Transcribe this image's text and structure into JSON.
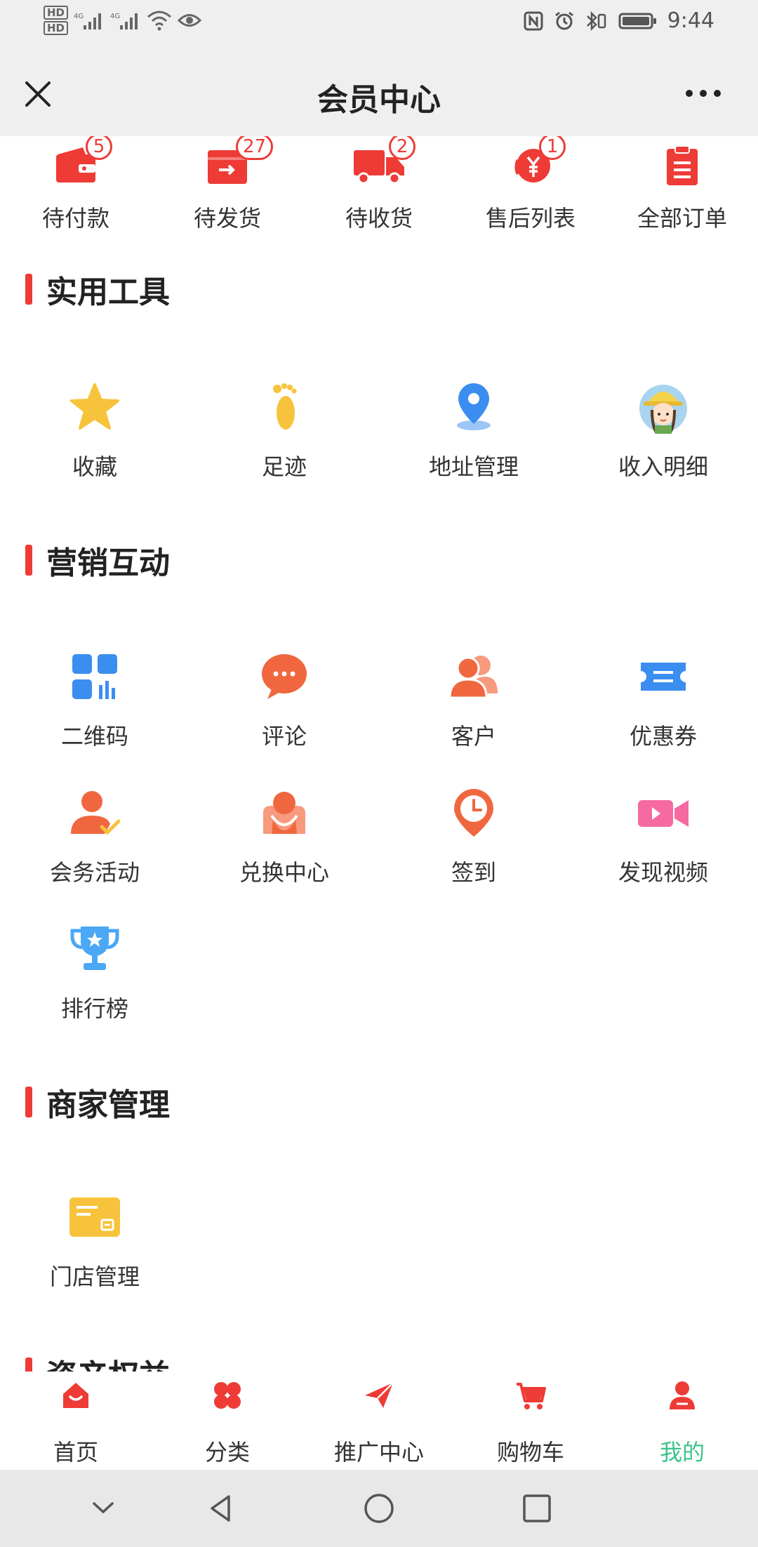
{
  "status_bar": {
    "hd1": "HD",
    "hd2": "HD",
    "net1": "4G",
    "net2": "4G",
    "time": "9:44"
  },
  "header": {
    "title": "会员中心"
  },
  "orders": [
    {
      "label": "待付款",
      "badge": "5",
      "icon": "wallet-icon"
    },
    {
      "label": "待发货",
      "badge": "27",
      "icon": "ship-box-icon"
    },
    {
      "label": "待收货",
      "badge": "2",
      "icon": "truck-icon"
    },
    {
      "label": "售后列表",
      "badge": "1",
      "icon": "yen-refund-icon"
    },
    {
      "label": "全部订单",
      "badge": "",
      "icon": "clipboard-icon"
    }
  ],
  "sections": {
    "tools": {
      "title": "实用工具",
      "items": [
        {
          "label": "收藏",
          "icon": "star-icon"
        },
        {
          "label": "足迹",
          "icon": "footprint-icon"
        },
        {
          "label": "地址管理",
          "icon": "location-pin-icon"
        },
        {
          "label": "收入明细",
          "icon": "avatar-girl-icon"
        }
      ]
    },
    "marketing": {
      "title": "营销互动",
      "items": [
        {
          "label": "二维码",
          "icon": "qrcode-icon"
        },
        {
          "label": "评论",
          "icon": "comment-icon"
        },
        {
          "label": "客户",
          "icon": "customers-icon"
        },
        {
          "label": "优惠券",
          "icon": "coupon-icon"
        },
        {
          "label": "会务活动",
          "icon": "event-check-icon"
        },
        {
          "label": "兑换中心",
          "icon": "exchange-icon"
        },
        {
          "label": "签到",
          "icon": "checkin-clock-icon"
        },
        {
          "label": "发现视频",
          "icon": "video-camera-icon"
        },
        {
          "label": "排行榜",
          "icon": "trophy-icon"
        }
      ]
    },
    "merchant": {
      "title": "商家管理",
      "items": [
        {
          "label": "门店管理",
          "icon": "store-card-icon"
        }
      ]
    },
    "assets": {
      "title": "资产权益"
    }
  },
  "tabbar": [
    {
      "label": "首页",
      "icon": "home-icon"
    },
    {
      "label": "分类",
      "icon": "category-icon"
    },
    {
      "label": "推广中心",
      "icon": "paper-plane-icon"
    },
    {
      "label": "购物车",
      "icon": "cart-icon"
    },
    {
      "label": "我的",
      "icon": "user-icon",
      "active": true
    }
  ],
  "colors": {
    "accent": "#ee3b36",
    "active_tab": "#3cc48c",
    "icon_blue": "#3b8ef0",
    "icon_orange": "#f0673f",
    "icon_yellow": "#f7c33c"
  }
}
